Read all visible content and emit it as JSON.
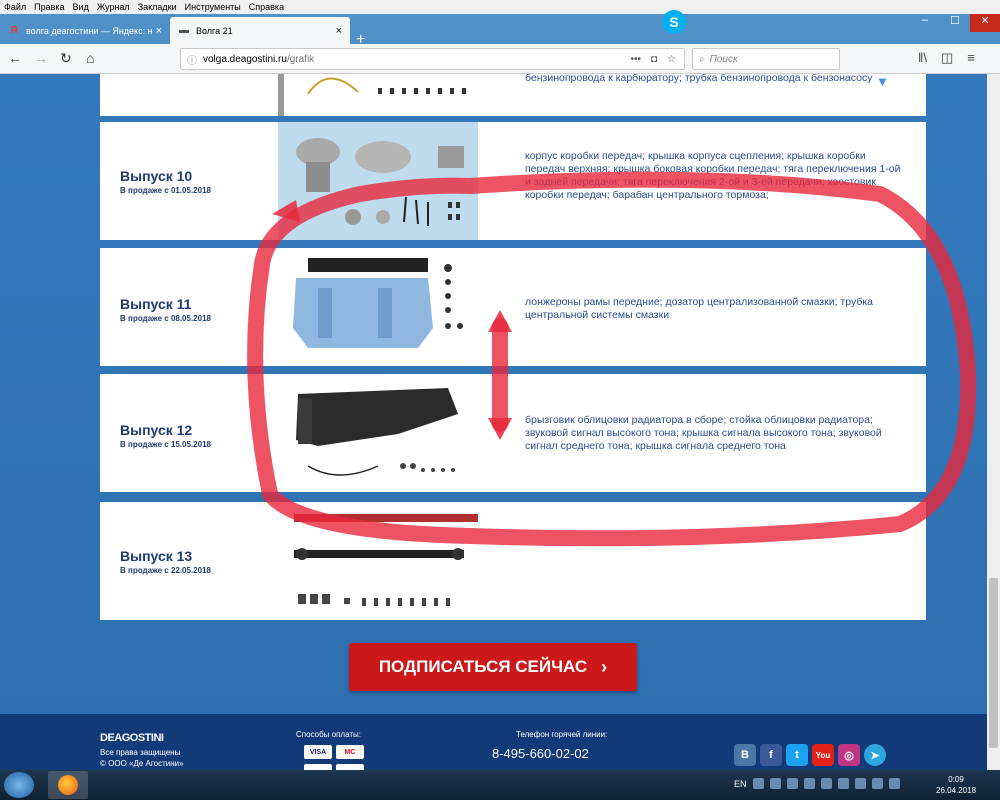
{
  "menubar": {
    "items": [
      "Файл",
      "Правка",
      "Вид",
      "Журнал",
      "Закладки",
      "Инструменты",
      "Справка"
    ]
  },
  "tabs": [
    {
      "title": "волга деагостини — Яндекс: н"
    },
    {
      "title": "Волга 21"
    }
  ],
  "navbar": {
    "url_domain": "volga.deagostini.ru",
    "url_path": "/grafik",
    "search_placeholder": "Поиск"
  },
  "issues": [
    {
      "title": "",
      "date": "",
      "desc": "бензинопровода к карбюратору; трубка бензинопровода к бензонасосу"
    },
    {
      "title": "Выпуск 10",
      "date": "В продаже с 01.05.2018",
      "desc": "корпус коробки передач; крышка корпуса сцепления; крышка коробки передач верхняя; крышка боковая коробки передач; тяга переключения 1-ой и задней передачи; тяга переключения 2-ой и 3-ей передачи; хвостовик коробки передач; барабан центрального тормоза;"
    },
    {
      "title": "Выпуск 11",
      "date": "В продаже с 08.05.2018",
      "desc": "лонжероны рамы передние; дозатор централизованной смазки; трубка центральной системы смазки"
    },
    {
      "title": "Выпуск 12",
      "date": "В продаже с 15.05.2018",
      "desc": "брызговик облицовки радиатора в сборе; стойка облицовки радиатора; звуковой сигнал высокого тона; крышка сигнала высокого тона; звуковой сигнал среднего тона; крышка сигнала среднего тона"
    },
    {
      "title": "Выпуск 13",
      "date": "В продаже с 22.05.2018",
      "desc": ""
    }
  ],
  "subscribe": {
    "label": "ПОДПИСАТЬСЯ СЕЙЧАС",
    "chevron": "›"
  },
  "footer": {
    "logo": "DEAGOSTINI",
    "rights_1": "Все права защищены",
    "rights_2": "© ООО «Де Агостини»",
    "payment_label": "Способы оплаты:",
    "card_1": "VISA",
    "card_2": "MC",
    "hotline_label": "Телефон горячей линии:",
    "phone": "8-495-660-02-02",
    "social": [
      {
        "name": "vk",
        "glyph": "B",
        "color": "#4a76a8"
      },
      {
        "name": "facebook",
        "glyph": "f",
        "color": "#3b5998"
      },
      {
        "name": "twitter",
        "glyph": "t",
        "color": "#1da1f2"
      },
      {
        "name": "youtube",
        "glyph": "You",
        "color": "#e62117"
      },
      {
        "name": "instagram",
        "glyph": "◎",
        "color": "#c13584"
      },
      {
        "name": "telegram",
        "glyph": "➤",
        "color": "#2ca5e0"
      }
    ]
  },
  "taskbar": {
    "lang": "EN",
    "time": "0:09",
    "date": "26.04.2018"
  },
  "colors": {
    "accent_red": "#e8283c",
    "brand_blue": "#1e3c72",
    "button_red": "#cc1818"
  }
}
